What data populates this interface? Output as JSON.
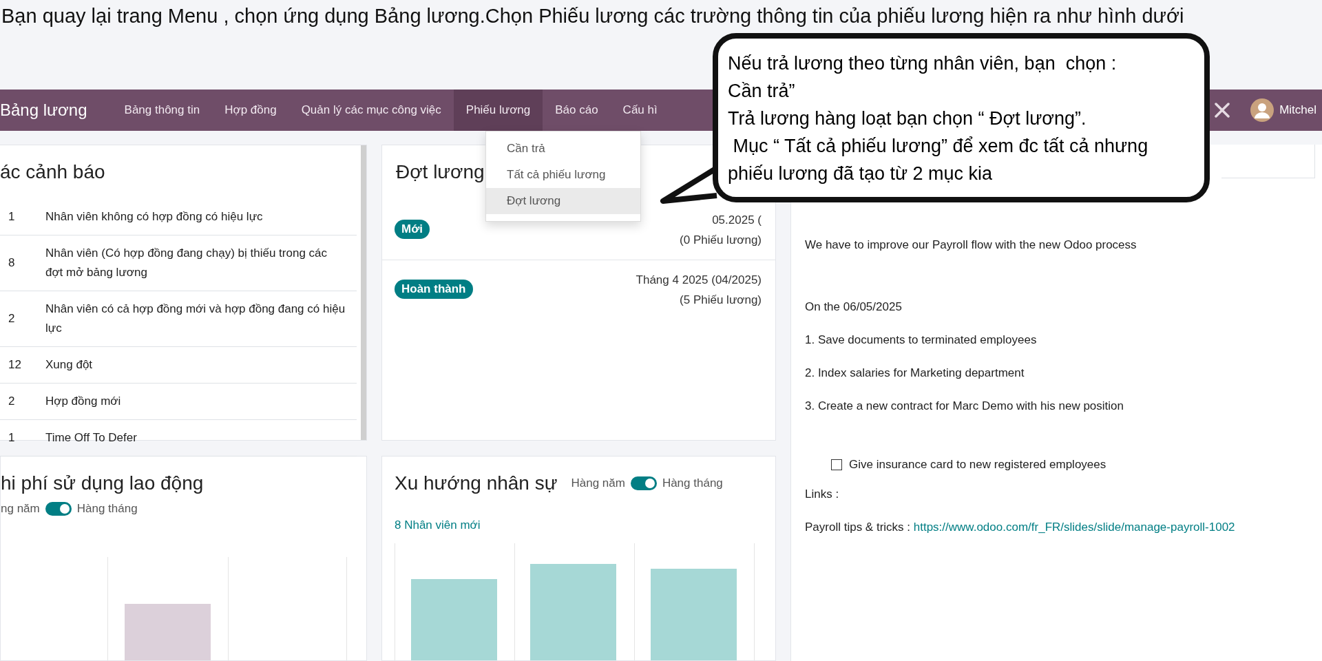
{
  "instruction": "Bạn quay lại trang Menu , chọn ứng dụng Bảng lương.Chọn Phiếu lương các trường thông tin của phiếu lương hiện ra như hình dưới",
  "navbar": {
    "brand": "Bảng lương",
    "items": [
      {
        "label": "Bảng thông tin",
        "selected": false
      },
      {
        "label": "Hợp đồng",
        "selected": false
      },
      {
        "label": "Quản lý các mục công việc",
        "selected": false
      },
      {
        "label": "Phiếu lương",
        "selected": true
      },
      {
        "label": "Báo cáo",
        "selected": false
      },
      {
        "label": "Cấu hì",
        "selected": false
      }
    ],
    "user": "Mitchel"
  },
  "dropdown": {
    "items": [
      {
        "label": "Cần trả",
        "selected": false
      },
      {
        "label": "Tất cả phiếu lương",
        "selected": false
      },
      {
        "label": "Đợt lương",
        "selected": true
      }
    ]
  },
  "callout": {
    "lines": [
      "Nếu trả lương theo từng nhân viên, bạn  chọn :",
      "Cần trả”",
      "Trả lương hàng loạt bạn chọn “ Đợt lương”.",
      " Mục “ Tất cả phiếu lương” để xem đc tất cả nhưng",
      "phiếu lương đã tạo từ 2 mục kia"
    ]
  },
  "alerts": {
    "title": "ác cảnh báo",
    "rows": [
      {
        "count": "1",
        "text": "Nhân viên không có hợp đồng có hiệu lực"
      },
      {
        "count": "8",
        "text": "Nhân viên (Có hợp đồng đang chạy) bị thiếu trong các đợt mở bảng lương"
      },
      {
        "count": "2",
        "text": "Nhân viên có cả hợp đồng mới và hợp đồng đang có hiệu lực"
      },
      {
        "count": "12",
        "text": "Xung đột"
      },
      {
        "count": "2",
        "text": "Hợp đồng mới"
      },
      {
        "count": "1",
        "text": "Time Off To Defer"
      }
    ]
  },
  "batches": {
    "title": "Đợt lương",
    "rows": [
      {
        "status": "Mới",
        "period": "05.2025 (",
        "count": "(0 Phiếu lương)"
      },
      {
        "status": "Hoàn thành",
        "period": "Tháng 4 2025 (04/2025)",
        "count": "(5 Phiếu lương)"
      }
    ]
  },
  "note": {
    "lines": [
      "We have to improve our Payroll flow with the new Odoo process",
      "On the 06/05/2025",
      "1. Save documents to terminated employees",
      "2. Index salaries for Marketing department",
      "3. Create a new contract for Marc Demo with his new position"
    ],
    "checklist": [
      {
        "label": "Give insurance card to new registered employees",
        "checked": false
      }
    ],
    "links_label": "Links :",
    "link_prefix": "Payroll tips & tricks :",
    "link": "https://www.odoo.com/fr_FR/slides/slide/manage-payroll-1002"
  },
  "labor_cost": {
    "title": "hi phí sử dụng lao động",
    "toggle": {
      "left": "ng năm",
      "right": "Hàng tháng",
      "on": true
    }
  },
  "headcount": {
    "title": "Xu hướng nhân sự",
    "toggle": {
      "left": "Hàng năm",
      "right": "Hàng tháng",
      "on": true
    },
    "summary": "8 Nhân viên mới"
  }
}
